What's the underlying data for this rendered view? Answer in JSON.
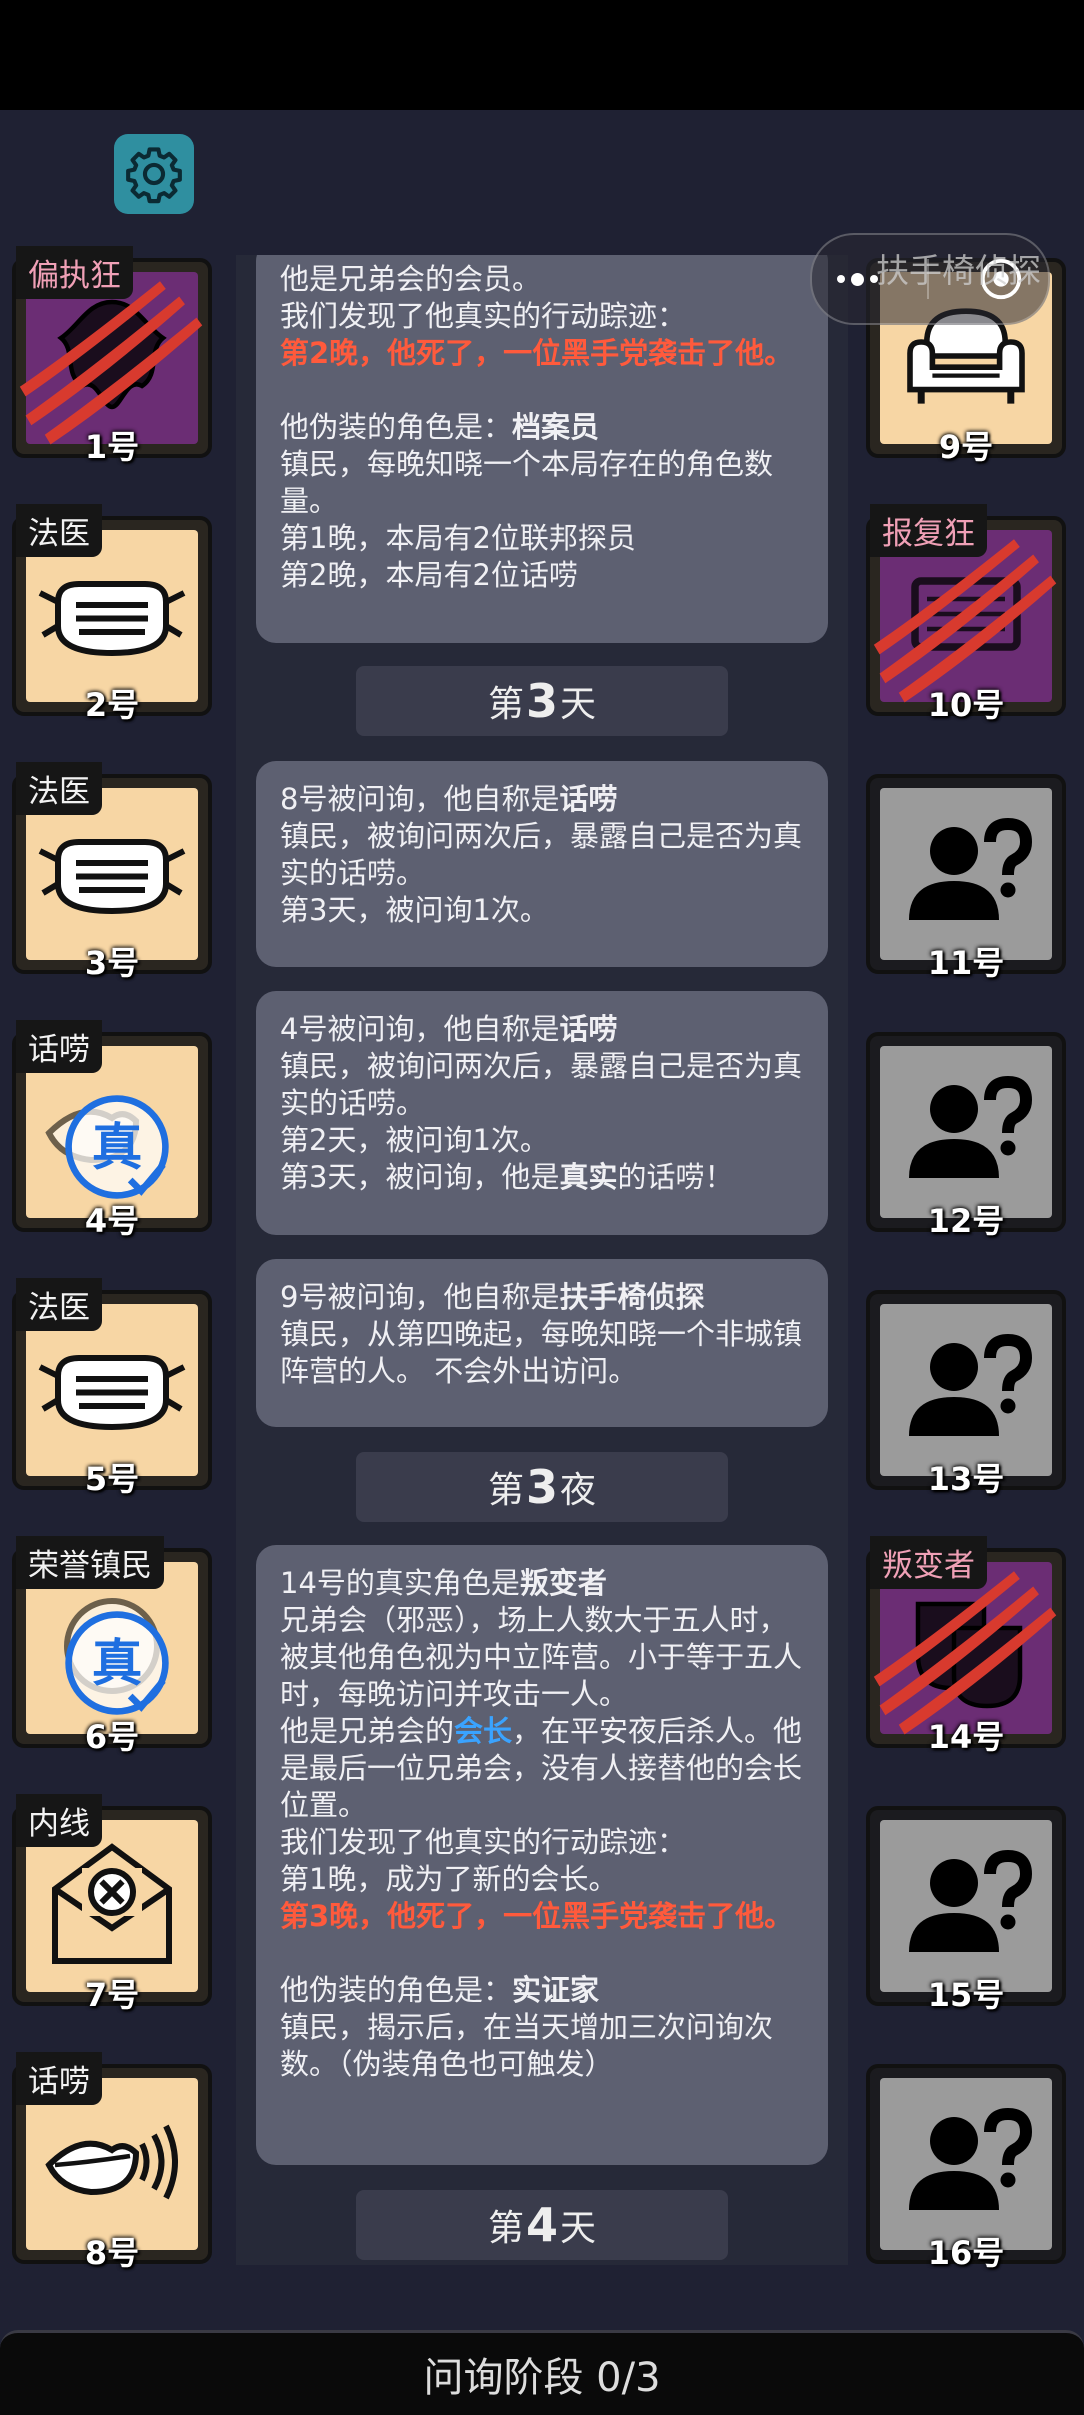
{
  "top_right_caption": "扶手椅侦探",
  "left_players": [
    {
      "role": "偏执狂",
      "number": "1号",
      "icon": "paranoid-icon",
      "style": "purple",
      "dead": true
    },
    {
      "role": "法医",
      "number": "2号",
      "icon": "mask-icon",
      "style": "peach"
    },
    {
      "role": "法医",
      "number": "3号",
      "icon": "mask-icon",
      "style": "peach"
    },
    {
      "role": "话唠",
      "number": "4号",
      "icon": "chatter-icon",
      "style": "peach",
      "verified_stamp": "真"
    },
    {
      "role": "法医",
      "number": "5号",
      "icon": "mask-icon",
      "style": "peach"
    },
    {
      "role": "荣誉镇民",
      "number": "6号",
      "icon": "honor-icon",
      "style": "peach",
      "verified_stamp": "真"
    },
    {
      "role": "内线",
      "number": "7号",
      "icon": "letter-x-icon",
      "style": "peach"
    },
    {
      "role": "话唠",
      "number": "8号",
      "icon": "mouth-icon",
      "style": "peach"
    }
  ],
  "right_players": [
    {
      "role": "",
      "number": "9号",
      "icon": "armchair-icon",
      "style": "peach"
    },
    {
      "role": "报复狂",
      "number": "10号",
      "icon": "revenge-icon",
      "style": "purple",
      "dead": true
    },
    {
      "role": "",
      "number": "11号",
      "icon": "unknown-person-icon",
      "style": "gray"
    },
    {
      "role": "",
      "number": "12号",
      "icon": "unknown-person-icon",
      "style": "gray"
    },
    {
      "role": "",
      "number": "13号",
      "icon": "unknown-person-icon",
      "style": "gray"
    },
    {
      "role": "叛变者",
      "number": "14号",
      "icon": "mask-theater-icon",
      "style": "purple",
      "dead": true
    },
    {
      "role": "",
      "number": "15号",
      "icon": "unknown-person-icon",
      "style": "gray"
    },
    {
      "role": "",
      "number": "16号",
      "icon": "unknown-person-icon",
      "style": "gray"
    }
  ],
  "log": {
    "msg1": {
      "l0": "他是兄弟会的会员。",
      "l1": "我们发现了他真实的行动踪迹：",
      "l2": "第2晚，他死了，一位黑手党袭击了他。",
      "l3a": "他伪装的角色是：",
      "l3b": "档案员",
      "l4": "镇民，每晚知晓一个本局存在的角色数量。",
      "l5": "第1晚，本局有2位联邦探员",
      "l6": "第2晚，本局有2位话唠"
    },
    "day3": {
      "pre": "第",
      "num": "3",
      "post": "天"
    },
    "msg2": {
      "l1a": "8号被问询，他自称是",
      "l1b": "话唠",
      "l2": "镇民，被询问两次后，暴露自己是否为真实的话唠。",
      "l3": "第3天，被问询1次。"
    },
    "msg3": {
      "l1a": "4号被问询，他自称是",
      "l1b": "话唠",
      "l2": "镇民，被询问两次后，暴露自己是否为真实的话唠。",
      "l3": "第2天，被问询1次。",
      "l4a": "第3天，被问询，他是",
      "l4b": "真实",
      "l4c": "的话唠！"
    },
    "msg4": {
      "l1a": "9号被问询，他自称是",
      "l1b": "扶手椅侦探",
      "l2": "镇民，从第四晚起，每晚知晓一个非城镇阵营的人。 不会外出访问。"
    },
    "night3": {
      "pre": "第",
      "num": "3",
      "post": "夜"
    },
    "msg5": {
      "l1a": "14号的真实角色是",
      "l1b": "叛变者",
      "l2": "兄弟会（邪恶），场上人数大于五人时，被其他角色视为中立阵营。小于等于五人时，每晚访问并攻击一人。",
      "l3a": "他是兄弟会的",
      "l3b": "会长",
      "l3c": "，在平安夜后杀人。他是最后一位兄弟会，没有人接替他的会长位置。",
      "l4": "我们发现了他真实的行动踪迹：",
      "l5": "第1晚，成为了新的会长。",
      "l6": "第3晚，他死了，一位黑手党袭击了他。",
      "l7a": "他伪装的角色是：",
      "l7b": "实证家",
      "l8": "镇民，揭示后，在当天增加三次问询次数。（伪装角色也可触发）"
    },
    "day4": {
      "pre": "第",
      "num": "4",
      "post": "天"
    }
  },
  "bottom_bar": "问询阶段 0/3",
  "colors": {
    "peach": "#f7d6a4",
    "purple": "#6b2d74",
    "gray": "#9b9b9b",
    "highlight_red": "#ff5a3c",
    "highlight_blue": "#3aa3ff"
  }
}
